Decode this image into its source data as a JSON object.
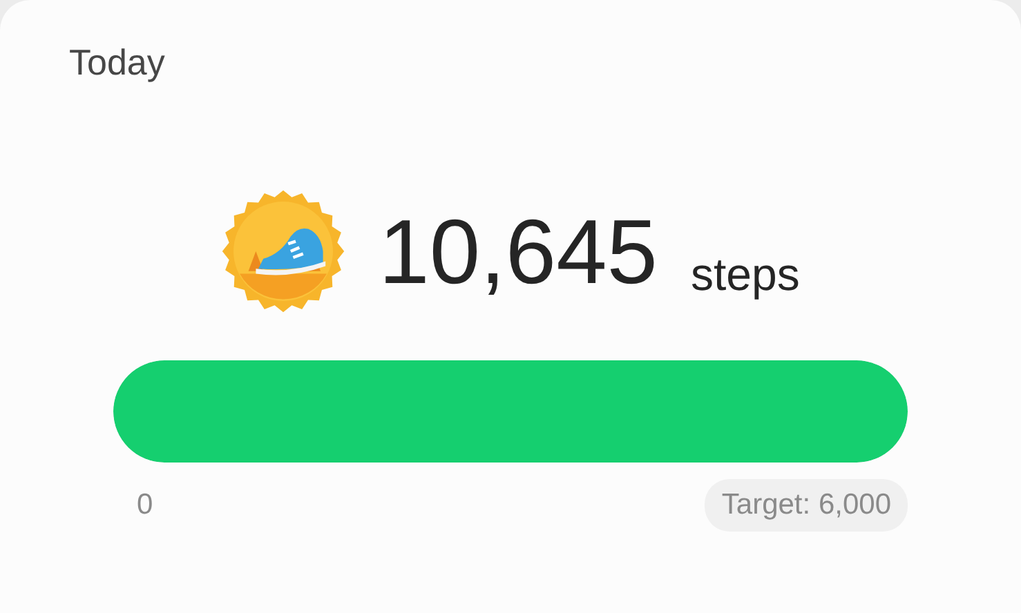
{
  "title": "Today",
  "steps": {
    "count": "10,645",
    "unit": "steps"
  },
  "progress": {
    "level": 1.0,
    "min_label": "0",
    "target_label": "Target: 6,000"
  }
}
